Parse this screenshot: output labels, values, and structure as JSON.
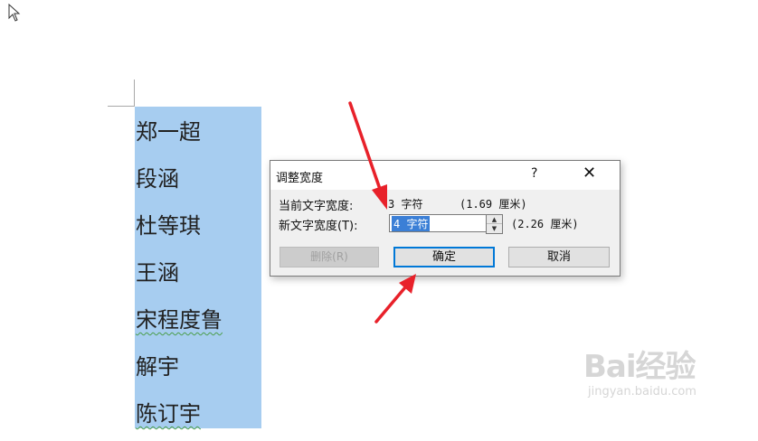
{
  "document": {
    "names": [
      "郑一超",
      "段涵",
      "杜等琪",
      "王涵",
      "宋程度鲁",
      "解宇",
      "陈订宇"
    ]
  },
  "dialog": {
    "title": "调整宽度",
    "help": "?",
    "close": "✕",
    "current_width_label": "当前文字宽度:",
    "current_width_value": "3 字符",
    "current_width_cm": "(1.69 厘米)",
    "new_width_label": "新文字宽度(T):",
    "new_width_value": "4 字符",
    "new_width_cm": "(2.26 厘米)",
    "buttons": {
      "delete": "删除(R)",
      "ok": "确定",
      "cancel": "取消"
    }
  },
  "watermark": {
    "brand": "Bai经验",
    "url": "jingyan.baidu.com"
  },
  "colors": {
    "selection": "#a7cdf0",
    "accent": "#0078d7",
    "arrow": "#e8212a"
  }
}
